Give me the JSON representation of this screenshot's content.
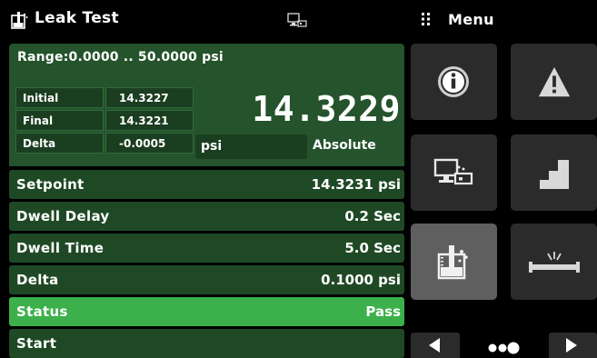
{
  "header": {
    "title": "Leak Test",
    "title_icon": "leak-test-beaker-icon",
    "connection_icon": "remote-connection-icon",
    "menu_icon": "grip-dots-icon",
    "menu_label": "Menu"
  },
  "range": {
    "label": "Range:0.0000 .. 50.0000 psi"
  },
  "measurements": [
    {
      "label": "Initial",
      "value": "14.3227"
    },
    {
      "label": "Final",
      "value": "14.3221"
    },
    {
      "label": "Delta",
      "value": "-0.0005"
    }
  ],
  "reading": {
    "value": "14.3229",
    "unit": "psi",
    "mode": "Absolute"
  },
  "rows": [
    {
      "label": "Setpoint",
      "value": "14.3231 psi"
    },
    {
      "label": "Dwell Delay",
      "value": "0.2 Sec"
    },
    {
      "label": "Dwell Time",
      "value": "5.0 Sec"
    },
    {
      "label": "Delta",
      "value": "0.1000 psi"
    },
    {
      "label": "Status",
      "value": "Pass"
    },
    {
      "label": "Start",
      "value": ""
    }
  ],
  "menu_tiles": [
    {
      "name": "info-icon",
      "active": false
    },
    {
      "name": "warning-icon",
      "active": false
    },
    {
      "name": "remote-connection-icon",
      "active": false
    },
    {
      "name": "step-staircase-icon",
      "active": false
    },
    {
      "name": "leak-test-beaker-icon",
      "active": true
    },
    {
      "name": "pipe-burst-icon",
      "active": false
    }
  ],
  "pager": {
    "prev_icon": "triangle-left-icon",
    "next_icon": "triangle-right-icon",
    "dots_icon": "page-dots-icon"
  },
  "colors": {
    "panel_green": "#24532c",
    "row_green": "#1f4925",
    "status_green": "#3cb04a",
    "tile_gray": "#2b2b2b",
    "tile_active": "#5f5f5f"
  }
}
